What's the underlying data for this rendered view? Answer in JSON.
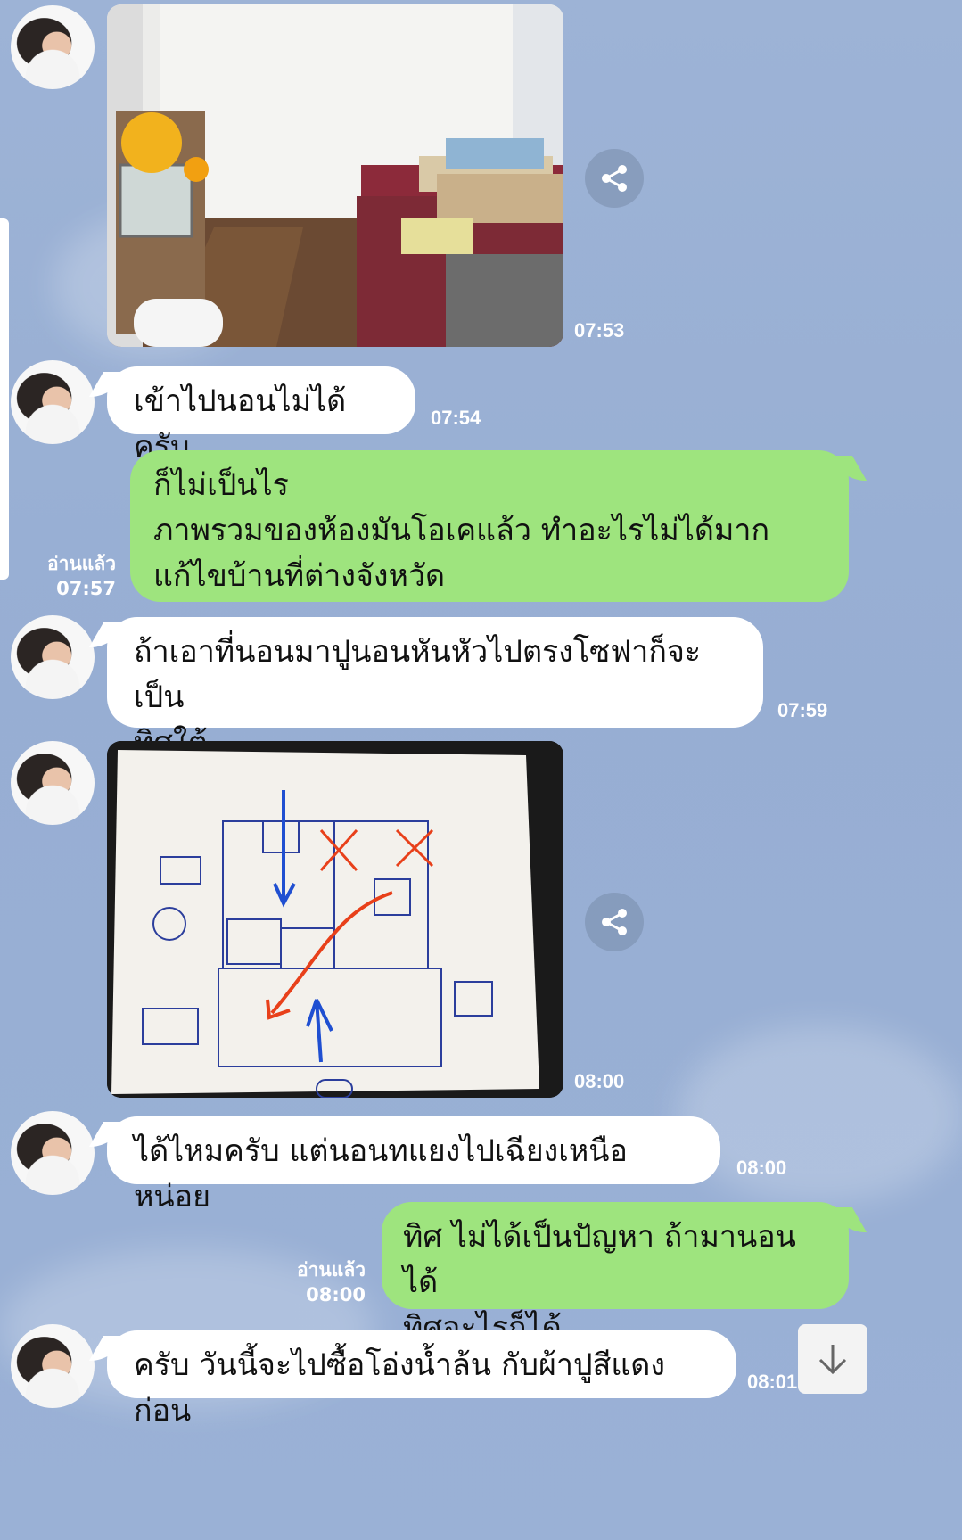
{
  "messages": [
    {
      "id": "m1",
      "time": "07:53"
    },
    {
      "id": "m2",
      "text": "เข้าไปนอนไม่ได้ครับ",
      "time": "07:54"
    },
    {
      "id": "m3",
      "lines": [
        "ก็ไม่เป็นไร",
        "ภาพรวมของห้องมันโอเคแล้ว ทำอะไรไม่ได้มาก",
        "แก้ไขบ้านที่ต่างจังหวัด"
      ],
      "read": "อ่านแล้ว",
      "time": "07:57"
    },
    {
      "id": "m4",
      "lines": [
        "ถ้าเอาที่นอนมาปูนอนหันหัวไปตรงโซฟาก็จะเป็น",
        "ทิศใต้"
      ],
      "time": "07:59"
    },
    {
      "id": "m5",
      "time": "08:00"
    },
    {
      "id": "m6",
      "text": "ได้ไหมครับ แต่นอนทแยงไปเฉียงเหนือหน่อย",
      "time": "08:00"
    },
    {
      "id": "m7",
      "lines": [
        "ทิศ ไม่ได้เป็นปัญหา ถ้ามานอนได้",
        "ทิศอะไรก็ได้"
      ],
      "read": "อ่านแล้ว",
      "time": "08:00"
    },
    {
      "id": "m8",
      "text": "ครับ วันนี้จะไปซื้อโอ่งน้ำล้น กับผ้าปูสีแดงก่อน",
      "time": "08:01"
    }
  ],
  "icons": {
    "share": "share-icon",
    "scroll": "arrow-down-icon",
    "avatar": "contact-avatar"
  },
  "colors": {
    "background": "#9db3d6",
    "outgoing": "#9ee47e",
    "incoming": "#ffffff"
  }
}
